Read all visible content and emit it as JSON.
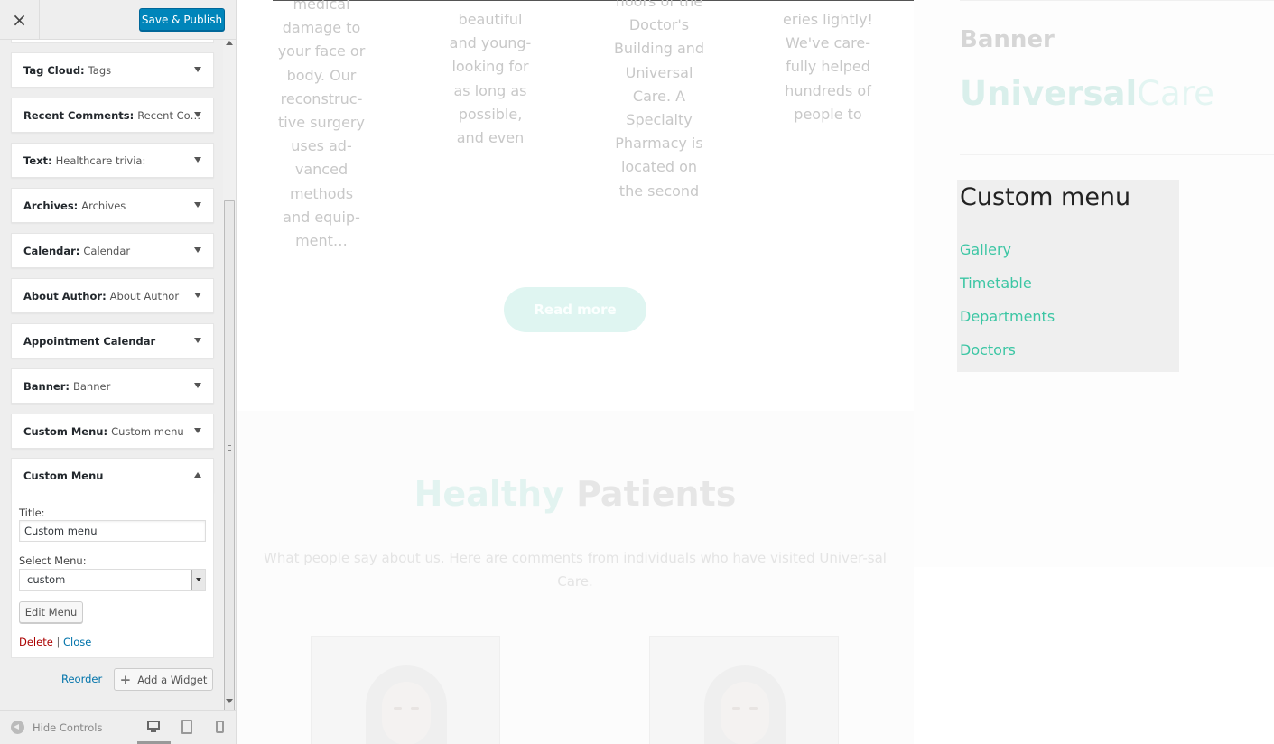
{
  "sidebar": {
    "close_label": "×",
    "publish_label": "Save & Publish",
    "widgets": [
      {
        "type": "Tag Cloud:",
        "title": "Tags"
      },
      {
        "type": "Recent Comments:",
        "title": "Recent Co…"
      },
      {
        "type": "Text:",
        "title": "Healthcare trivia:"
      },
      {
        "type": "Archives:",
        "title": "Archives"
      },
      {
        "type": "Calendar:",
        "title": "Calendar"
      },
      {
        "type": "About Author:",
        "title": "About Author"
      },
      {
        "type": "Appointment Calendar",
        "title": ""
      },
      {
        "type": "Banner:",
        "title": "Banner"
      },
      {
        "type": "Custom Menu:",
        "title": "Custom menu"
      },
      {
        "type": "Custom Menu",
        "title": ""
      }
    ],
    "open_widget": {
      "title_label": "Title:",
      "title_value": "Custom menu",
      "menu_label": "Select Menu:",
      "menu_value": "custom",
      "edit_menu_label": "Edit Menu",
      "delete_label": "Delete",
      "separator": "|",
      "close_label": "Close"
    },
    "reorder_label": "Reorder",
    "add_widget_label": "Add a Widget",
    "hide_controls_label": "Hide Controls",
    "active_device": "desktop",
    "accent_color": "#0085ba"
  },
  "preview": {
    "service_columns": [
      [
        "medical",
        "damage to",
        "your face or",
        "body. Our",
        "reconstruc-",
        "tive surgery",
        "uses ad-",
        "vanced",
        "methods",
        "and equip-",
        "ment…"
      ],
      [
        "beautiful",
        "and young-",
        "looking for",
        "as long as",
        "possible,",
        "and even"
      ],
      [
        "floors of the",
        "Doctor's",
        "Building and",
        "Universal",
        "Care. A",
        "Specialty",
        "Pharmacy is",
        "located on",
        "the second"
      ],
      [
        "eries lightly!",
        "We've care-",
        "fully helped",
        "hundreds of",
        "people to"
      ]
    ],
    "read_more_label": "Read more",
    "testimonials": {
      "heading_accent": "Healthy",
      "heading_rest": "Patients",
      "subtext": "What people say about us. Here are comments from individuals who have visited Univer-sal Care."
    },
    "sidebar_widgets": {
      "banner_title": "Banner",
      "logo_bold": "Universal",
      "logo_light": "Care",
      "menu_title": "Custom menu",
      "menu_items": [
        "Gallery",
        "Timetable",
        "Departments",
        "Doctors"
      ],
      "link_color": "#3cc6a4"
    }
  }
}
